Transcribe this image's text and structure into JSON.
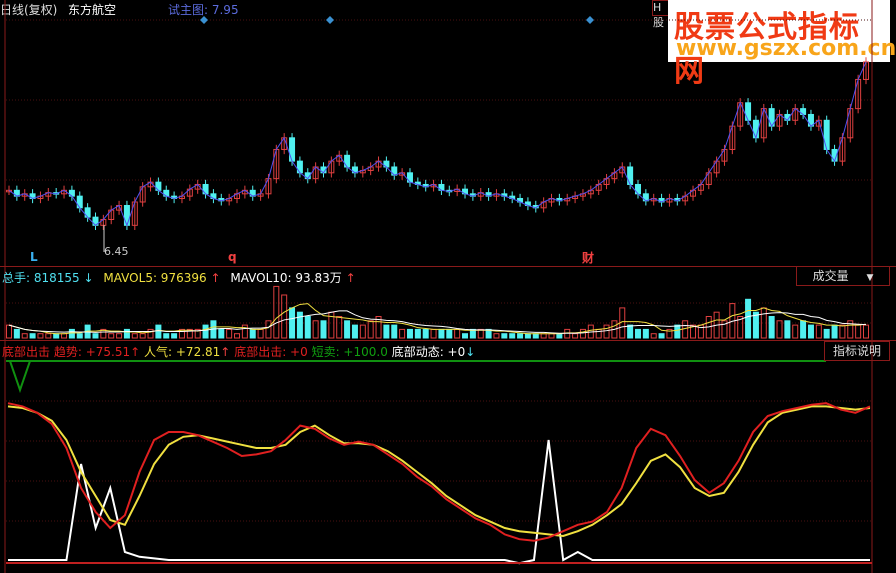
{
  "header": {
    "period": "日线(复权)",
    "stock_name": "东方航空",
    "main_indicator": "试主图: 7.95",
    "h_button": "H股"
  },
  "watermark": {
    "title": "股票公式指标网",
    "url": "www.gszx.com.cn"
  },
  "price_chart": {
    "low_label": "6.45",
    "markers": [
      {
        "text": "L",
        "color": "#3ab0f0"
      },
      {
        "text": "q",
        "color": "#f04040"
      },
      {
        "text": "财",
        "color": "#f04040"
      }
    ],
    "closes": [
      6.85,
      6.8,
      6.82,
      6.78,
      6.8,
      6.83,
      6.82,
      6.85,
      6.8,
      6.7,
      6.62,
      6.55,
      6.6,
      6.68,
      6.72,
      6.55,
      6.75,
      6.88,
      6.92,
      6.85,
      6.8,
      6.78,
      6.8,
      6.86,
      6.9,
      6.82,
      6.78,
      6.76,
      6.78,
      6.82,
      6.85,
      6.8,
      6.82,
      6.95,
      7.2,
      7.3,
      7.1,
      7.0,
      6.95,
      7.05,
      7.0,
      7.1,
      7.15,
      7.05,
      7.0,
      7.02,
      7.05,
      7.1,
      7.05,
      6.98,
      7.0,
      6.92,
      6.9,
      6.88,
      6.9,
      6.85,
      6.84,
      6.86,
      6.82,
      6.8,
      6.83,
      6.8,
      6.82,
      6.8,
      6.78,
      6.75,
      6.72,
      6.7,
      6.75,
      6.78,
      6.76,
      6.78,
      6.8,
      6.82,
      6.85,
      6.9,
      6.95,
      7.0,
      7.05,
      6.9,
      6.82,
      6.76,
      6.78,
      6.75,
      6.78,
      6.76,
      6.8,
      6.85,
      6.9,
      7.0,
      7.1,
      7.2,
      7.4,
      7.6,
      7.45,
      7.3,
      7.55,
      7.4,
      7.5,
      7.45,
      7.55,
      7.5,
      7.4,
      7.45,
      7.2,
      7.1,
      7.3,
      7.55,
      7.8,
      7.95
    ]
  },
  "volume_panel": {
    "total_label": "总手: 818155",
    "total_arrow": "↓",
    "mavol5_label": "MAVOL5: 976396",
    "mavol5_arrow": "↑",
    "mavol10_label": "MAVOL10: 93.83万",
    "mavol10_arrow": "↑",
    "selector": "成交量",
    "selector_icon": "caret-down",
    "volumes": [
      3,
      2,
      1,
      1,
      1,
      1,
      1,
      1,
      2,
      1,
      3,
      1,
      2,
      1,
      1,
      2,
      1,
      1,
      2,
      3,
      1,
      1,
      2,
      2,
      2,
      3,
      4,
      2,
      2,
      1,
      3,
      2,
      2,
      4,
      12,
      10,
      7,
      6,
      5,
      4,
      4,
      6,
      5,
      4,
      3,
      3,
      4,
      5,
      3,
      3,
      2,
      2,
      2,
      2,
      2,
      2,
      2,
      2,
      1,
      2,
      2,
      2,
      1,
      1,
      1,
      1,
      1,
      1,
      1,
      1,
      1,
      2,
      1,
      2,
      3,
      2,
      3,
      4,
      7,
      3,
      2,
      2,
      1,
      1,
      2,
      3,
      4,
      3,
      3,
      5,
      6,
      4,
      8,
      5,
      9,
      6,
      7,
      5,
      4,
      4,
      3,
      4,
      3,
      3,
      2,
      3,
      3,
      4,
      3,
      3
    ],
    "up_color": "#e04040",
    "down_color": "#50f0f0"
  },
  "indicator_panel": {
    "name": "底部出击",
    "trend": "趋势: +75.51",
    "trend_arrow": "↑",
    "popularity": "人气: +72.81",
    "popularity_arrow": "↑",
    "bottom_attack": "底部出击: +0",
    "short_sell": "短卖: +100.0",
    "bottom_dynamic": "底部动态: +0",
    "bottom_dynamic_arrow": "↓",
    "help_button": "指标说明",
    "red_line": [
      98,
      96,
      92,
      85,
      70,
      45,
      30,
      20,
      28,
      55,
      75,
      80,
      80,
      78,
      74,
      70,
      65,
      66,
      68,
      75,
      84,
      82,
      76,
      72,
      74,
      72,
      66,
      60,
      52,
      46,
      38,
      32,
      26,
      22,
      16,
      13,
      12,
      14,
      18,
      22,
      24,
      30,
      45,
      70,
      82,
      78,
      65,
      50,
      42,
      48,
      62,
      80,
      90,
      93,
      95,
      97,
      98,
      94,
      92,
      96
    ],
    "yellow_line": [
      96,
      95,
      92,
      87,
      75,
      55,
      40,
      25,
      22,
      40,
      60,
      72,
      77,
      78,
      76,
      74,
      72,
      70,
      70,
      72,
      80,
      84,
      78,
      73,
      73,
      72,
      68,
      62,
      55,
      48,
      40,
      34,
      28,
      24,
      20,
      18,
      17,
      16,
      15,
      18,
      22,
      28,
      35,
      48,
      62,
      66,
      58,
      45,
      40,
      42,
      55,
      72,
      86,
      92,
      94,
      96,
      96,
      95,
      94,
      95
    ],
    "white_line": [
      0,
      0,
      0,
      0,
      0,
      60,
      20,
      45,
      5,
      2,
      1,
      0,
      0,
      0,
      0,
      0,
      0,
      0,
      0,
      0,
      0,
      0,
      0,
      0,
      0,
      0,
      0,
      0,
      0,
      0,
      0,
      0,
      0,
      0,
      0,
      -2,
      0,
      75,
      0,
      5,
      0,
      0,
      0,
      0,
      0,
      0,
      0,
      0,
      0,
      0,
      0,
      0,
      0,
      0,
      0,
      0,
      0,
      0,
      0,
      0
    ],
    "colors": {
      "red": "#e02020",
      "yellow": "#f0e040",
      "white": "#ffffff",
      "signal": "#109010"
    }
  }
}
